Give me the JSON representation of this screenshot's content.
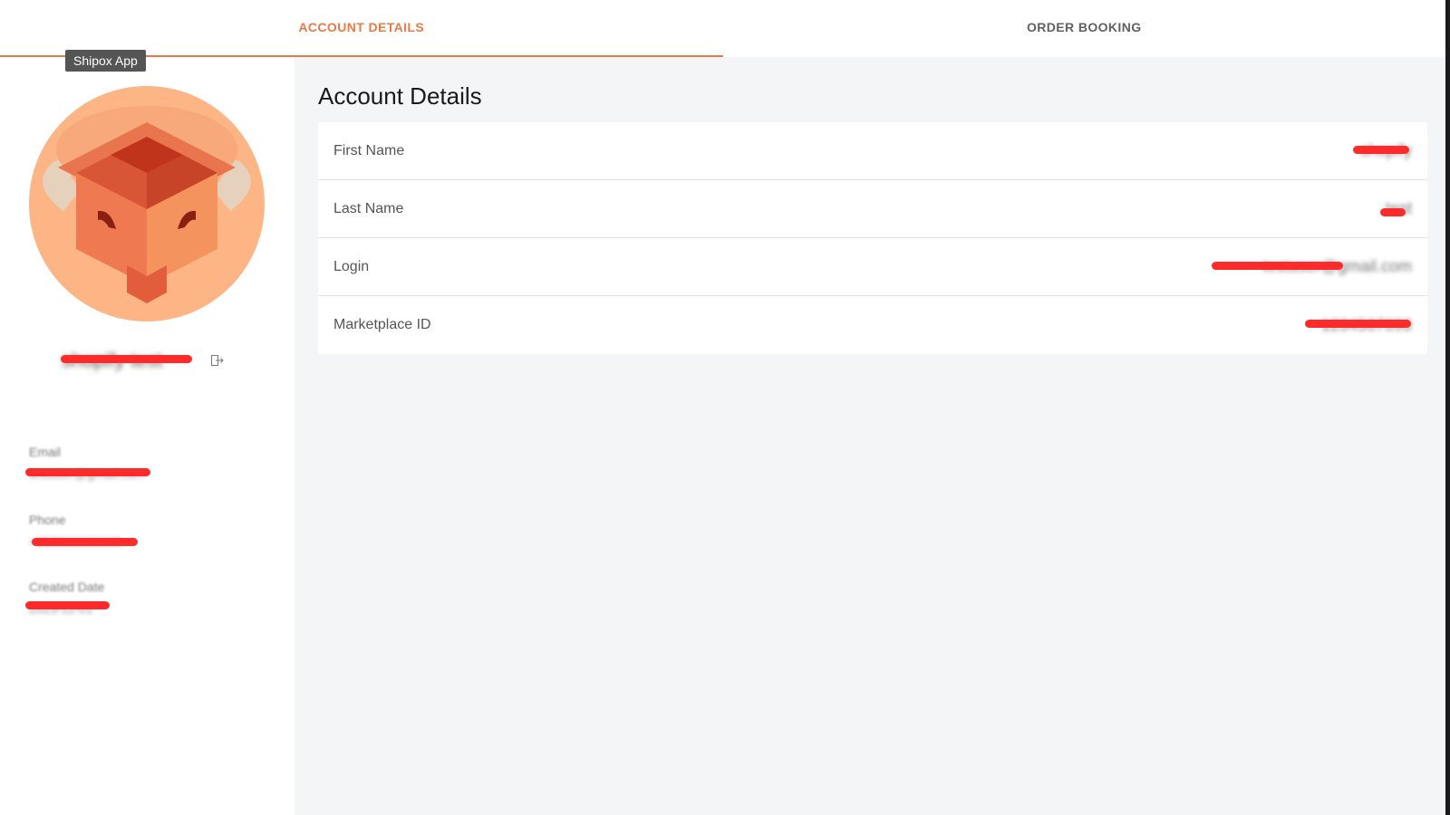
{
  "tabs": [
    {
      "label": "ACCOUNT DETAILS",
      "active": true
    },
    {
      "label": "ORDER BOOKING",
      "active": false
    }
  ],
  "tooltip": "Shipox App",
  "sidebar": {
    "username": "shopify test",
    "logout_icon": "logout-icon",
    "email": {
      "label": "Email",
      "value": "testuser@gmail.com"
    },
    "phone": {
      "label": "Phone",
      "value": "+998900000000"
    },
    "created": {
      "label": "Created Date",
      "value": "2023-11-01"
    }
  },
  "main": {
    "title": "Account Details",
    "rows": [
      {
        "label": "First Name",
        "value": "shopify"
      },
      {
        "label": "Last Name",
        "value": "test"
      },
      {
        "label": "Login",
        "value": "testuser@gmail.com"
      },
      {
        "label": "Marketplace ID",
        "value": "1234567890"
      }
    ]
  },
  "colors": {
    "accent": "#ea7a47",
    "redaction": "#ff2b2b",
    "main_bg": "#f4f5f7"
  }
}
